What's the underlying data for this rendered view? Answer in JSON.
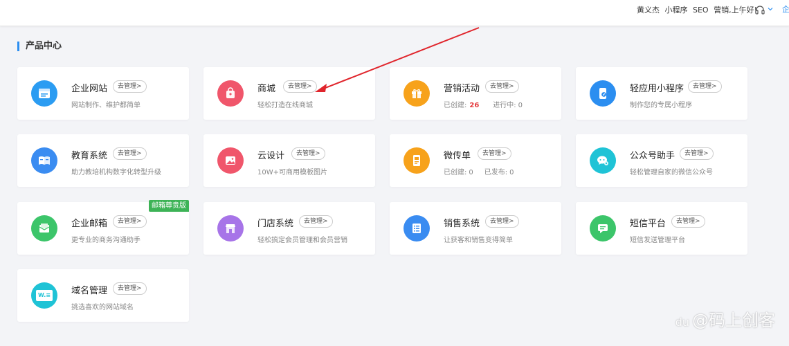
{
  "header": {
    "user_name": "黄义杰",
    "link_mini": "小程序",
    "link_seo": "SEO",
    "greeting": "营销,上午好!",
    "tail_text": "企"
  },
  "section": {
    "title": "产品中心"
  },
  "products": [
    {
      "title": "企业网站",
      "manage": "去管理>",
      "desc": "网站制作、维护都简单",
      "icon": "website-icon",
      "color": "#2b9cf2"
    },
    {
      "title": "商城",
      "manage": "去管理>",
      "desc": "轻松打造在线商城",
      "icon": "shopping-bag-icon",
      "color": "#f0566b"
    },
    {
      "title": "营销活动",
      "manage": "去管理>",
      "created_label": "已创建:",
      "created_value": "26",
      "active_label": "进行中:",
      "active_value": "0",
      "icon": "gift-icon",
      "color": "#f7a21b"
    },
    {
      "title": "轻应用小程序",
      "manage": "去管理>",
      "desc": "制作您的专属小程序",
      "icon": "mini-program-icon",
      "color": "#2b8ef0"
    },
    {
      "title": "教育系统",
      "manage": "去管理>",
      "desc": "助力教培机构数字化转型升级",
      "icon": "book-icon",
      "color": "#3a8cf1"
    },
    {
      "title": "云设计",
      "manage": "去管理>",
      "desc": "10W+可商用模板图片",
      "icon": "image-icon",
      "color": "#f0566b"
    },
    {
      "title": "微传单",
      "manage": "去管理>",
      "created_label": "已创建:",
      "created_value": "0",
      "published_label": "已发布:",
      "published_value": "0",
      "icon": "flyer-icon",
      "color": "#f7a21b"
    },
    {
      "title": "公众号助手",
      "manage": "去管理>",
      "desc": "轻松管理自家的微信公众号",
      "icon": "wechat-icon",
      "color": "#1fc3d6"
    },
    {
      "title": "企业邮箱",
      "manage": "去管理>",
      "desc": "更专业的商务沟通助手",
      "badge": "邮箱尊贵版",
      "icon": "mail-icon",
      "color": "#3cc56a"
    },
    {
      "title": "门店系统",
      "manage": "去管理>",
      "desc": "轻松搞定会员管理和会员营销",
      "icon": "store-icon",
      "color": "#a774e8"
    },
    {
      "title": "销售系统",
      "manage": "去管理>",
      "desc": "让获客和销售变得简单",
      "icon": "list-icon",
      "color": "#3a8cf1"
    },
    {
      "title": "短信平台",
      "manage": "去管理>",
      "desc": "短信发送管理平台",
      "icon": "sms-icon",
      "color": "#3cc56a"
    },
    {
      "title": "域名管理",
      "manage": "去管理>",
      "desc": "挑选喜欢的网站域名",
      "icon": "domain-icon",
      "icon_text": "W.≡",
      "color": "#1fc3d6"
    }
  ],
  "annotation": {
    "color": "#e0252c"
  },
  "watermark": {
    "text": "@码上创客",
    "logo_text": "du"
  }
}
